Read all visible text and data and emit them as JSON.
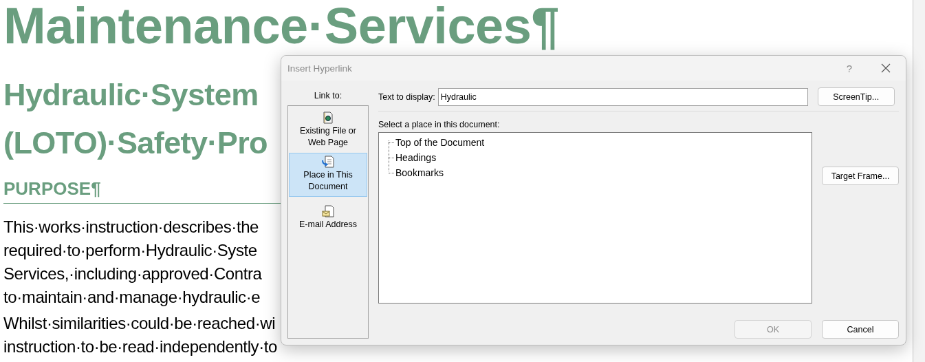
{
  "document": {
    "title": "Maintenance·Services¶",
    "heading_lines": [
      "Hydraulic·System",
      "(LOTO)·Safety·Pro"
    ],
    "section_heading": "PURPOSE¶",
    "paragraphs": [
      {
        "lines": [
          "This·works·instruction·describes·the",
          "required·to·perform·Hydraulic·Syste",
          "Services,·including·approved·Contra",
          "to·maintain·and·manage·hydraulic·e"
        ]
      },
      {
        "lines": [
          "Whilst·similarities·could·be·reached·wi",
          "instruction·to·be·read·independently·to"
        ]
      }
    ]
  },
  "dialog": {
    "title": "Insert Hyperlink",
    "help": "?",
    "link_to": {
      "label": "Link to:",
      "items": [
        {
          "kind": "file",
          "label_lines": [
            "Existing File or",
            "Web Page"
          ],
          "selected": false
        },
        {
          "kind": "place",
          "label_lines": [
            "Place in This",
            "Document"
          ],
          "selected": true
        },
        {
          "kind": "email",
          "label_lines": [
            "E-mail Address"
          ],
          "selected": false
        }
      ]
    },
    "text_to_display": {
      "label": "Text to display:",
      "value": "Hydraulic"
    },
    "screentip_button": "ScreenTip...",
    "place_label": "Select a place in this document:",
    "tree": [
      {
        "label": "Top of the Document"
      },
      {
        "label": "Headings"
      },
      {
        "label": "Bookmarks"
      }
    ],
    "target_frame_button": "Target Frame...",
    "buttons": [
      {
        "label": "OK",
        "disabled": true
      },
      {
        "label": "Cancel",
        "disabled": false
      }
    ]
  }
}
